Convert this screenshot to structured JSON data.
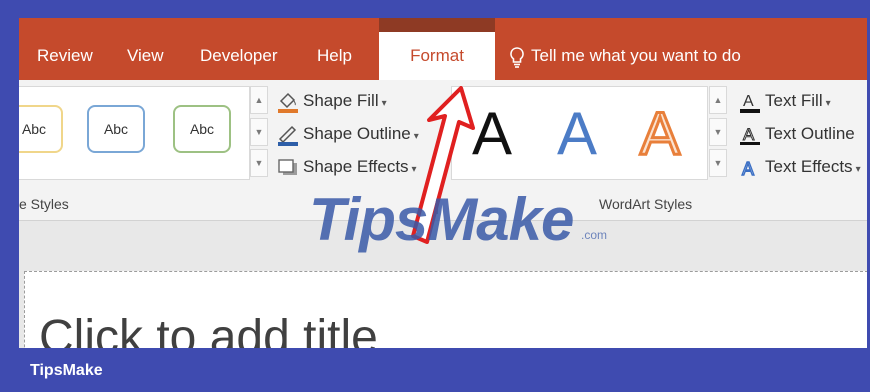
{
  "tabs": [
    {
      "label": "Review"
    },
    {
      "label": "View"
    },
    {
      "label": "Developer"
    },
    {
      "label": "Help"
    },
    {
      "label": "Format"
    }
  ],
  "tell_me": "Tell me what you want to do",
  "shape_styles": {
    "samples": [
      "Abc",
      "Abc",
      "Abc"
    ],
    "group_label": "e Styles"
  },
  "shape_commands": {
    "fill": "Shape Fill",
    "outline": "Shape Outline",
    "effects": "Shape Effects"
  },
  "wordart": {
    "letters": [
      "A",
      "A",
      "A"
    ],
    "group_label": "WordArt Styles"
  },
  "text_commands": {
    "fill": "Text Fill",
    "outline": "Text Outline",
    "effects": "Text Effects"
  },
  "slide": {
    "title_placeholder": "Click to add title"
  },
  "watermark": {
    "main": "TipsMake",
    "com": ".com"
  },
  "footer": {
    "brand": "TipsMake"
  },
  "colors": {
    "ribbon_tab_bg": "#c54a2c",
    "frame": "#3f4bb0",
    "abc1_border": "#f0d68a",
    "abc2_border": "#7aa7d6",
    "abc3_border": "#9dc183",
    "arrow": "#e02020"
  }
}
